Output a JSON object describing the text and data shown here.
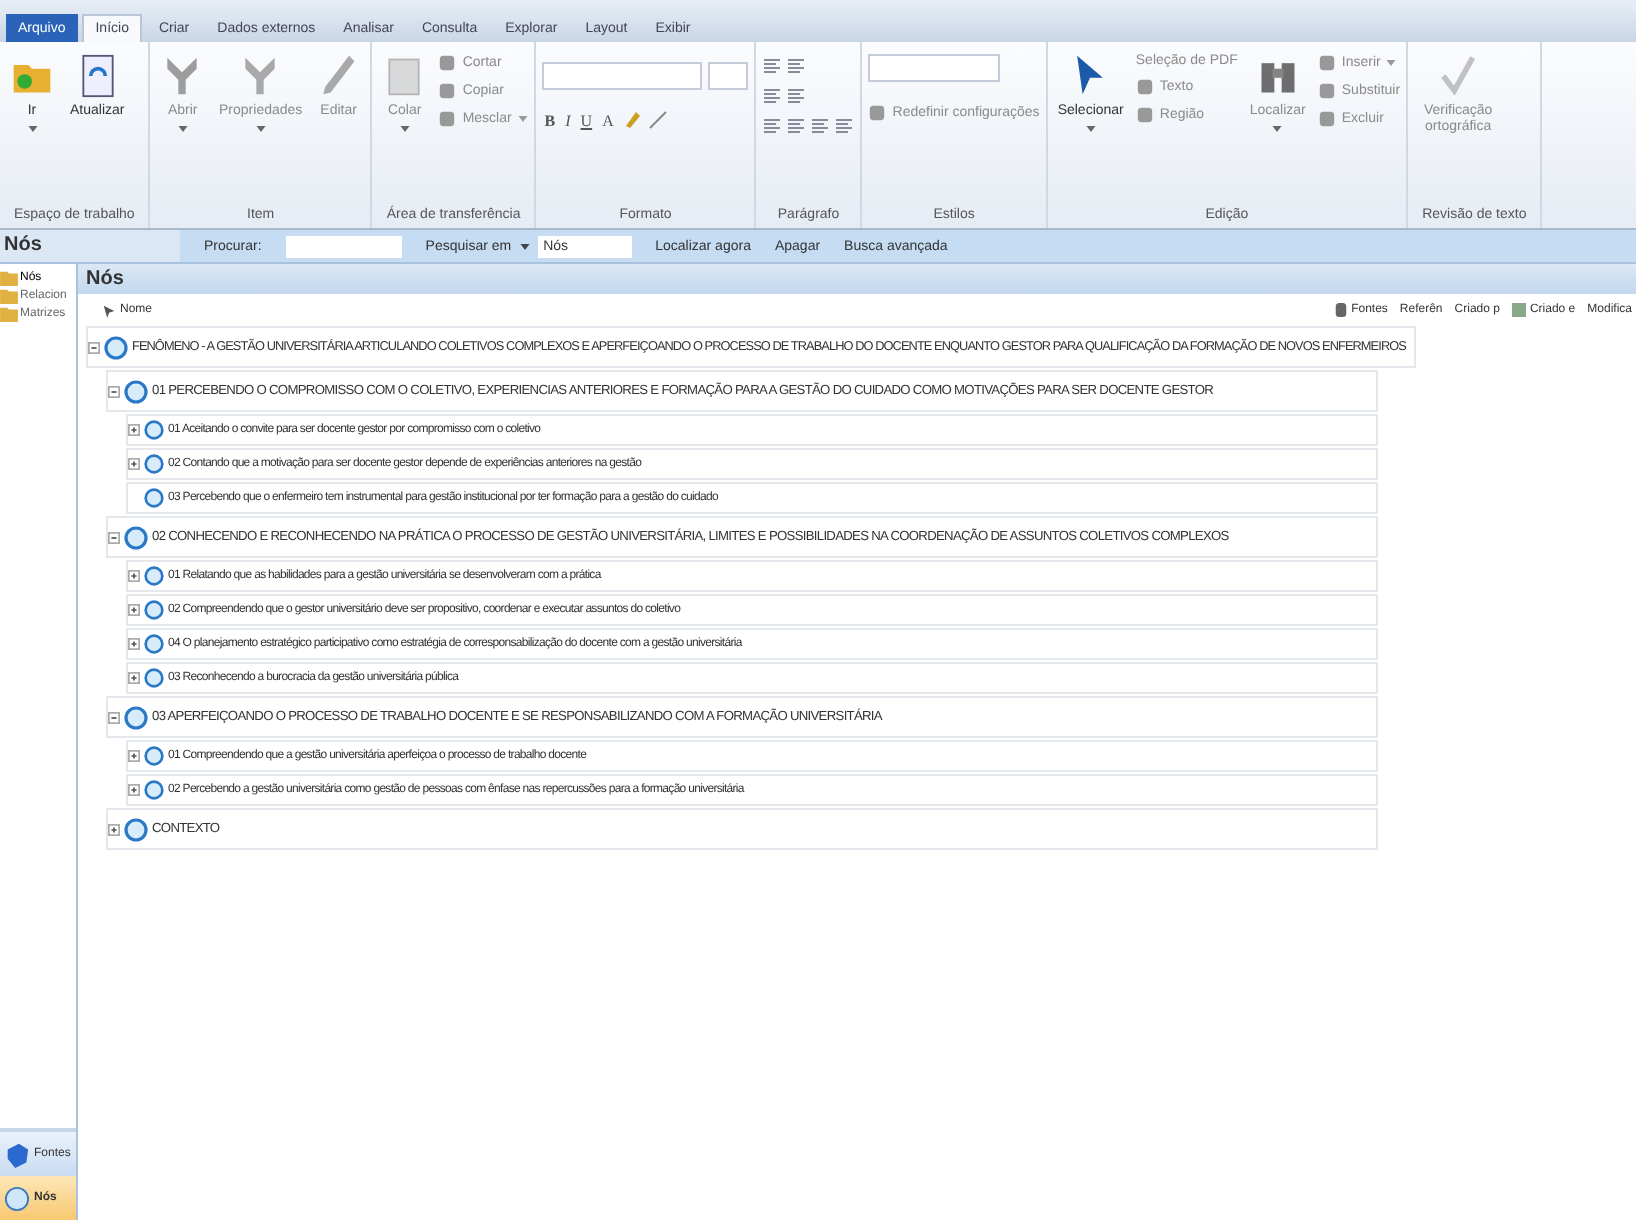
{
  "tabs": [
    {
      "label": "Arquivo",
      "kind": "file",
      "selected": false
    },
    {
      "label": "Início",
      "kind": "tab",
      "selected": true
    },
    {
      "label": "Criar",
      "kind": "tab",
      "selected": false
    },
    {
      "label": "Dados externos",
      "kind": "tab",
      "selected": false
    },
    {
      "label": "Analisar",
      "kind": "tab",
      "selected": false
    },
    {
      "label": "Consulta",
      "kind": "tab",
      "selected": false
    },
    {
      "label": "Explorar",
      "kind": "tab",
      "selected": false
    },
    {
      "label": "Layout",
      "kind": "tab",
      "selected": false
    },
    {
      "label": "Exibir",
      "kind": "tab",
      "selected": false
    }
  ],
  "ribbon": [
    {
      "label": "Espaço de trabalho",
      "items": [
        {
          "kind": "large",
          "label": "Ir",
          "dropdown": true,
          "disabled": false
        },
        {
          "kind": "large",
          "label": "Atualizar",
          "dropdown": false,
          "disabled": false
        }
      ]
    },
    {
      "label": "Item",
      "items": [
        {
          "kind": "large",
          "label": "Abrir",
          "dropdown": true,
          "disabled": true
        },
        {
          "kind": "large",
          "label": "Propriedades",
          "dropdown": true,
          "disabled": true
        },
        {
          "kind": "large",
          "label": "Editar",
          "dropdown": false,
          "disabled": true
        }
      ]
    },
    {
      "label": "Área de transferência",
      "items": [
        {
          "kind": "large",
          "label": "Colar",
          "dropdown": true,
          "disabled": true
        },
        {
          "kind": "stack",
          "buttons": [
            {
              "label": "Cortar",
              "dropdown": false,
              "disabled": true
            },
            {
              "label": "Copiar",
              "dropdown": false,
              "disabled": true
            },
            {
              "label": "Mesclar",
              "dropdown": true,
              "disabled": true
            }
          ]
        }
      ]
    },
    {
      "label": "Formato",
      "items": [
        {
          "kind": "format",
          "letters": [
            "B",
            "I",
            "U",
            "A"
          ]
        }
      ]
    },
    {
      "label": "Parágrafo",
      "items": [
        {
          "kind": "paragraph"
        }
      ]
    },
    {
      "label": "Estilos",
      "items": [
        {
          "kind": "styles",
          "button": {
            "label": "Redefinir configurações",
            "dropdown": false,
            "disabled": true
          }
        }
      ]
    },
    {
      "label": "Edição",
      "items": [
        {
          "kind": "large",
          "label": "Selecionar",
          "dropdown": true,
          "disabled": false
        },
        {
          "kind": "stack",
          "buttons": [
            {
              "label": "Seleção de PDF",
              "dropdown": false,
              "disabled": true
            },
            {
              "label": "Texto",
              "dropdown": false,
              "disabled": true
            },
            {
              "label": "Região",
              "dropdown": false,
              "disabled": true
            }
          ]
        },
        {
          "kind": "large",
          "label": "Localizar",
          "dropdown": true,
          "disabled": true
        },
        {
          "kind": "stack",
          "buttons": [
            {
              "label": "Inserir",
              "dropdown": true,
              "disabled": true
            },
            {
              "label": "Substituir",
              "dropdown": false,
              "disabled": true
            },
            {
              "label": "Excluir",
              "dropdown": false,
              "disabled": true
            }
          ]
        }
      ]
    },
    {
      "label": "Revisão de texto",
      "items": [
        {
          "kind": "large",
          "label": "Verificação ortográfica",
          "dropdown": false,
          "disabled": true
        }
      ]
    }
  ],
  "search_bar": {
    "title": "Nós",
    "find_label": "Procurar:",
    "search_in": "Pesquisar em",
    "search_in_value": "Nós",
    "find_now": "Localizar agora",
    "clear": "Apagar",
    "advanced": "Busca avançada"
  },
  "navigation": {
    "folders": [
      {
        "label": "Nós",
        "selected": true
      },
      {
        "label": "Relacion",
        "selected": false
      },
      {
        "label": "Matrizes",
        "selected": false
      }
    ],
    "buttons": [
      {
        "label": "Fontes",
        "selected": false
      },
      {
        "label": "Nós",
        "selected": true
      }
    ]
  },
  "list": {
    "title": "Nós",
    "columns": [
      "Nome",
      "Fontes",
      "Referên",
      "Criado p",
      "Criado e",
      "Modifica"
    ],
    "nodes": [
      {
        "label": "FENÔMENO - A GESTÃO UNIVERSITÁRIA ARTICULANDO COLETIVOS COMPLEXOS E APERFEIÇOANDO O PROCESSO DE TRABALHO DO DOCENTE ENQUANTO GESTOR PARA QUALIFICAÇÃO DA FORMAÇÃO DE NOVOS ENFERMEIROS",
        "expanded": true,
        "has_children": true,
        "children": [
          {
            "label": "01 PERCEBENDO O COMPROMISSO COM O COLETIVO, EXPERIENCIAS ANTERIORES  E FORMAÇÃO PARA A GESTÃO DO CUIDADO COMO MOTIVAÇÕES PARA SER DOCENTE GESTOR",
            "expanded": true,
            "has_children": true,
            "children": [
              {
                "label": "01 Aceitando o convite para ser docente gestor por compromisso com o coletivo",
                "expanded": false,
                "has_children": true
              },
              {
                "label": "02 Contando que a motivação para ser docente gestor depende de experiências anteriores na gestão",
                "expanded": false,
                "has_children": true
              },
              {
                "label": "03 Percebendo que o enfermeiro tem instrumental para gestão institucional por ter formação para a gestão do cuidado",
                "expanded": false,
                "has_children": false
              }
            ]
          },
          {
            "label": "02 CONHECENDO E RECONHECENDO NA PRÁTICA O PROCESSO DE GESTÃO UNIVERSITÁRIA, LIMITES E POSSIBILIDADES NA COORDENAÇÃO DE ASSUNTOS COLETIVOS COMPLEXOS",
            "expanded": true,
            "has_children": true,
            "children": [
              {
                "label": "01 Relatando que as habilidades para a gestão universitária se desenvolveram com a prática",
                "expanded": false,
                "has_children": true
              },
              {
                "label": "02 Compreendendo que o gestor universitário deve ser propositivo, coordenar e executar assuntos do coletivo",
                "expanded": false,
                "has_children": true
              },
              {
                "label": "04 O planejamento estratégico participativo como estratégia de corresponsabilização do docente com a gestão universitária",
                "expanded": false,
                "has_children": true
              },
              {
                "label": "03 Reconhecendo a burocracia da gestão universitária pública",
                "expanded": false,
                "has_children": true
              }
            ]
          },
          {
            "label": "03 APERFEIÇOANDO O PROCESSO DE TRABALHO DOCENTE  E SE RESPONSABILIZANDO COM A FORMAÇÃO UNIVERSITÁRIA",
            "expanded": true,
            "has_children": true,
            "children": [
              {
                "label": "01 Compreendendo que a gestão universitária aperfeiçoa o processo de trabalho docente",
                "expanded": false,
                "has_children": true
              },
              {
                "label": "02 Percebendo a gestão universitária como gestão de pessoas com ênfase nas repercussões para a formação universitária",
                "expanded": false,
                "has_children": true
              }
            ]
          },
          {
            "label": "CONTEXTO",
            "expanded": false,
            "has_children": true
          }
        ]
      }
    ]
  }
}
